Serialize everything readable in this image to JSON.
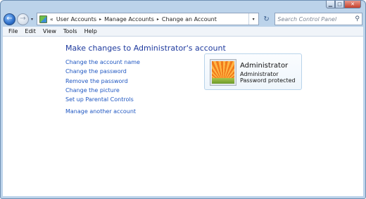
{
  "window": {
    "caption_buttons": {
      "minimize": "▁",
      "maximize": "□",
      "close": "✕"
    }
  },
  "toolbar": {
    "back_icon": "←",
    "forward_icon": "→",
    "history_drop": "▾",
    "address_chevron": "«",
    "breadcrumbs": [
      "User Accounts",
      "Manage Accounts",
      "Change an Account"
    ],
    "breadcrumb_separator": "▸",
    "address_drop": "▾",
    "refresh_icon": "↻",
    "search_placeholder": "Search Control Panel",
    "search_icon": "⚲"
  },
  "menu": [
    "File",
    "Edit",
    "View",
    "Tools",
    "Help"
  ],
  "main": {
    "heading": "Make changes to Administrator's account",
    "tasks": [
      "Change the account name",
      "Change the password",
      "Remove the password",
      "Change the picture",
      "Set up Parental Controls"
    ],
    "other_task": "Manage another account"
  },
  "account": {
    "name": "Administrator",
    "role": "Administrator",
    "status": "Password protected"
  },
  "colors": {
    "link": "#1f57c2",
    "heading": "#1e3a9e",
    "frame": "#bcd3ea"
  }
}
